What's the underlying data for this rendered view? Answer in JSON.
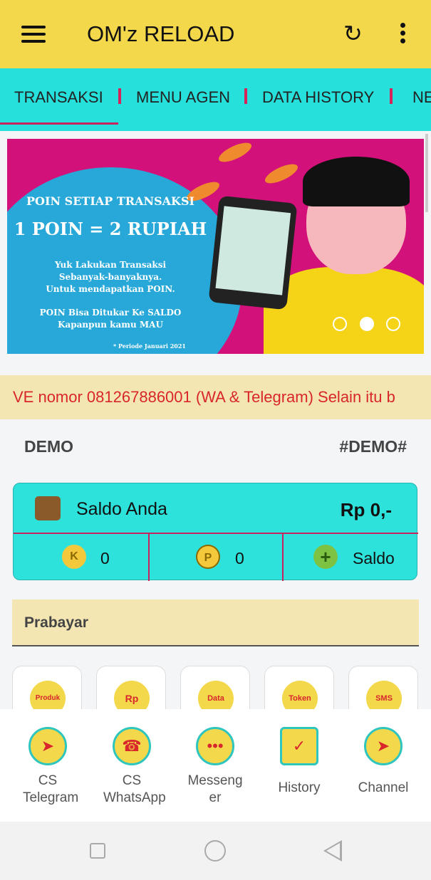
{
  "header": {
    "title": "OM'z RELOAD",
    "menu_icon": "hamburger-icon",
    "refresh_icon": "refresh-icon",
    "more_icon": "more-vert-icon"
  },
  "tabs": [
    {
      "label": "TRANSAKSI",
      "active": true
    },
    {
      "label": "MENU AGEN"
    },
    {
      "label": "DATA HISTORY"
    },
    {
      "label": "NE"
    }
  ],
  "banner": {
    "line1": "POIN SETIAP TRANSAKSI",
    "line2": "1 POIN = 2 RUPIAH",
    "line3": "Yuk Lakukan Transaksi",
    "line4": "Sebanyak-banyaknya.",
    "line5": "Untuk mendapatkan POIN.",
    "line6": "POIN Bisa Ditukar Ke SALDO",
    "line7": "Kapanpun kamu MAU",
    "footnote": "* Periode Januari 2021",
    "slides": 3,
    "active_slide": 2
  },
  "ticker": "VE nomor 081267886001 (WA & Telegram) Selain itu b",
  "account": {
    "name": "DEMO",
    "code": "#DEMO#"
  },
  "balance": {
    "label": "Saldo Anda",
    "value": "Rp 0,-",
    "komisi": "0",
    "poin": "0",
    "add_label": "Saldo",
    "colors": {
      "card": "#2ee2dc",
      "divider": "#c7245e"
    }
  },
  "section": {
    "title": "Prabayar"
  },
  "tiles": [
    {
      "label": "Produk CUAN"
    },
    {
      "label": "Rp"
    },
    {
      "label": "Data"
    },
    {
      "label": "Token"
    },
    {
      "label": "SMS"
    }
  ],
  "bottom_nav": [
    {
      "label": "CS Telegram",
      "icon": "telegram-icon"
    },
    {
      "label": "CS WhatsApp",
      "icon": "whatsapp-icon"
    },
    {
      "label": "Messenger",
      "icon": "chat-icon"
    },
    {
      "label": "History",
      "icon": "document-check-icon"
    },
    {
      "label": "Channel",
      "icon": "channel-icon"
    }
  ]
}
